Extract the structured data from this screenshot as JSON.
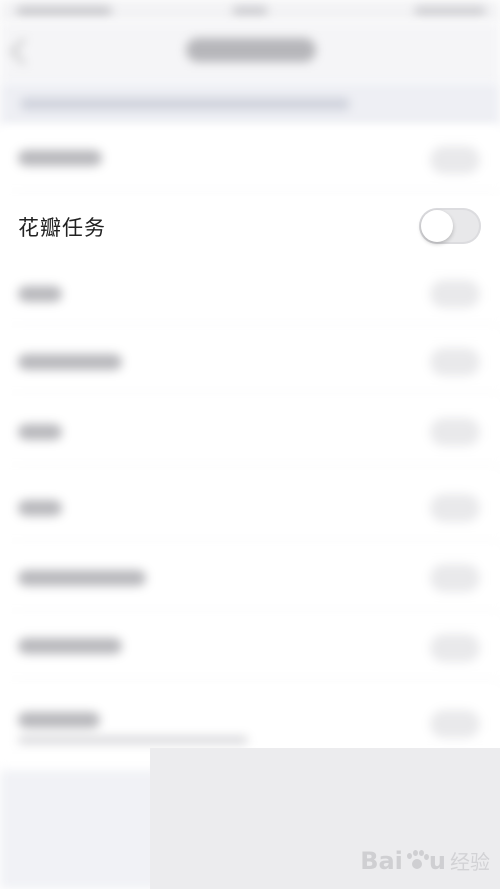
{
  "settings": {
    "items": [
      {
        "label": "花瓣任务",
        "toggle_on": false
      }
    ]
  },
  "watermark": {
    "brand_a": "Bai",
    "brand_b": "u",
    "suffix": "经验"
  },
  "colors": {
    "background": "#ffffff",
    "section_header": "#eeeff4",
    "toggle_off": "#e8e8ea",
    "text": "#222222"
  }
}
